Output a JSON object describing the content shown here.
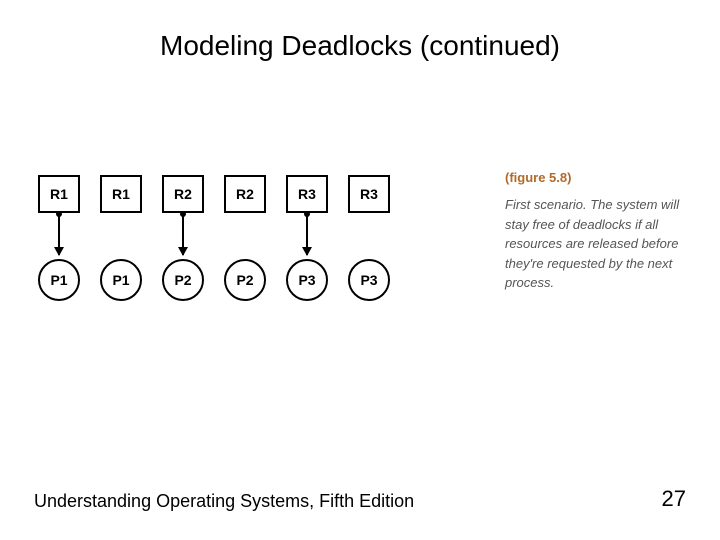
{
  "title": "Modeling Deadlocks (continued)",
  "diagram": {
    "pairs": [
      {
        "resource": "R1",
        "process": "P1",
        "arrow": true
      },
      {
        "resource": "R1",
        "process": "P1",
        "arrow": false
      },
      {
        "resource": "R2",
        "process": "P2",
        "arrow": true
      },
      {
        "resource": "R2",
        "process": "P2",
        "arrow": false
      },
      {
        "resource": "R3",
        "process": "P3",
        "arrow": true
      },
      {
        "resource": "R3",
        "process": "P3",
        "arrow": false
      }
    ]
  },
  "caption": {
    "figure": "(figure 5.8)",
    "text": "First scenario. The system will stay free of deadlocks if all resources are released before they're requested by the next process."
  },
  "footer": {
    "source": "Understanding Operating Systems, Fifth Edition",
    "page": "27"
  }
}
